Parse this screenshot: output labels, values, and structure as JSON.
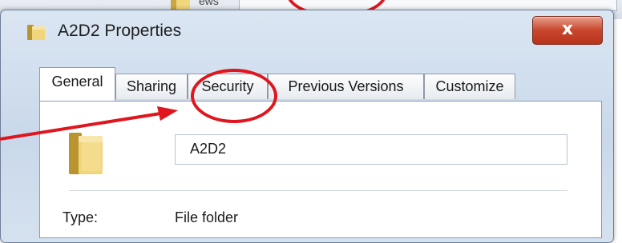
{
  "background": {
    "list_text": "ews"
  },
  "window": {
    "title": "A2D2 Properties",
    "close_label": "x"
  },
  "tabs": [
    {
      "label": "General",
      "active": true
    },
    {
      "label": "Sharing",
      "active": false
    },
    {
      "label": "Security",
      "active": false
    },
    {
      "label": "Previous Versions",
      "active": false
    },
    {
      "label": "Customize",
      "active": false
    }
  ],
  "general": {
    "folder_name": "A2D2",
    "type_label": "Type:",
    "type_value": "File folder"
  },
  "annotation": {
    "color": "#e0161e",
    "highlighted_tab": "Security"
  },
  "icons": {
    "title": "folder-icon",
    "main": "folder-icon",
    "close": "close-icon"
  }
}
